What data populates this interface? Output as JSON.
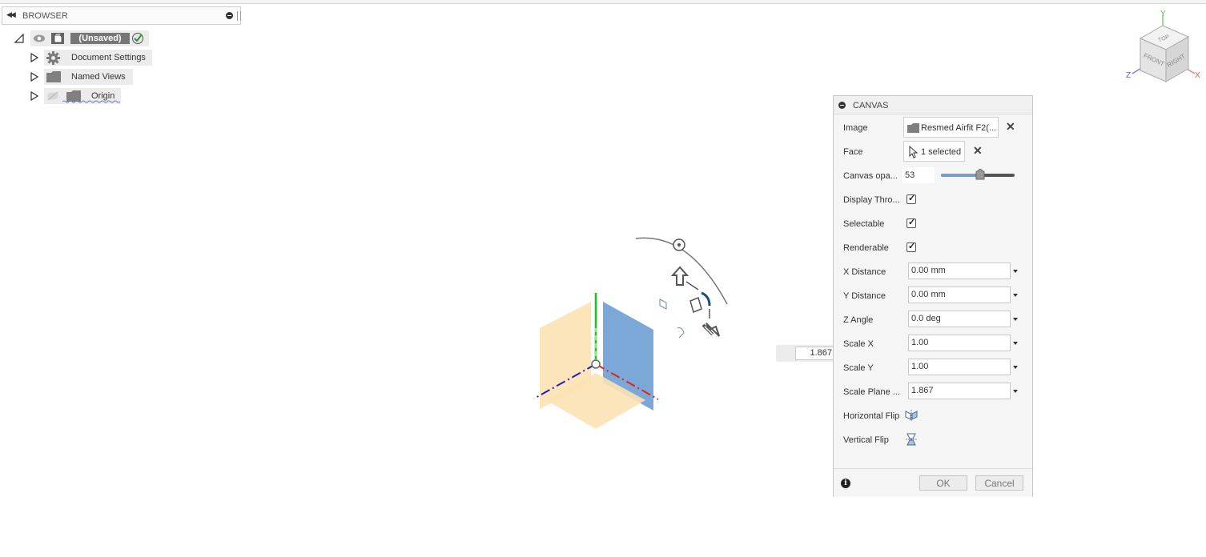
{
  "browser": {
    "title": "BROWSER",
    "root": {
      "label": "(Unsaved)"
    },
    "items": [
      {
        "label": "Document Settings",
        "icon": "gear-icon"
      },
      {
        "label": "Named Views",
        "icon": "folder-icon"
      },
      {
        "label": "Origin",
        "icon": "folder-icon"
      }
    ]
  },
  "viewcube": {
    "top": "TOP",
    "front": "FRONT",
    "right": "RIGHT",
    "x": "X",
    "y": "Y",
    "z": "Z"
  },
  "float_input": {
    "value": "1.867"
  },
  "dialog": {
    "title": "CANVAS",
    "image": {
      "label": "Image",
      "value": "Resmed Airfit F2(..."
    },
    "face": {
      "label": "Face",
      "value": "1 selected"
    },
    "opacity": {
      "label": "Canvas opa...",
      "value": "53",
      "percent": 53
    },
    "display_through": {
      "label": "Display Thro...",
      "checked": true
    },
    "selectable": {
      "label": "Selectable",
      "checked": true
    },
    "renderable": {
      "label": "Renderable",
      "checked": true
    },
    "x_distance": {
      "label": "X Distance",
      "value": "0.00 mm"
    },
    "y_distance": {
      "label": "Y Distance",
      "value": "0.00 mm"
    },
    "z_angle": {
      "label": "Z Angle",
      "value": "0.0 deg"
    },
    "scale_x": {
      "label": "Scale X",
      "value": "1.00"
    },
    "scale_y": {
      "label": "Scale Y",
      "value": "1.00"
    },
    "scale_plane": {
      "label": "Scale Plane ...",
      "value": "1.867"
    },
    "horizontal_flip": {
      "label": "Horizontal Flip"
    },
    "vertical_flip": {
      "label": "Vertical Flip"
    },
    "ok": "OK",
    "cancel": "Cancel"
  },
  "colors": {
    "accent": "#7a9bd0",
    "axis_x": "#e02020",
    "axis_y": "#20c020",
    "axis_z": "#2020c0",
    "plane_blue": "#6e9fd4",
    "plane_orange": "#fde2b4"
  }
}
